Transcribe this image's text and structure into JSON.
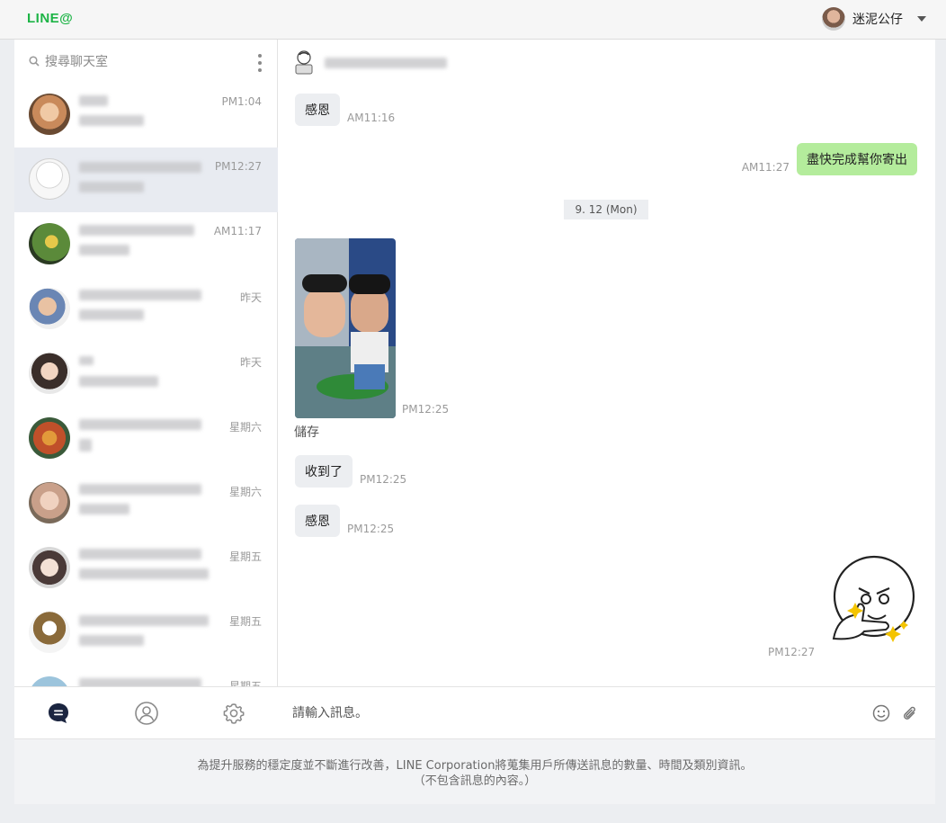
{
  "app": {
    "logo": "LINE@"
  },
  "user": {
    "name": "迷泥公仔"
  },
  "search": {
    "placeholder": "搜尋聊天室"
  },
  "chats": [
    {
      "time": "PM1:04",
      "avatar_color": "#c98a5b"
    },
    {
      "time": "PM12:27",
      "avatar_color": "#f4f4f4"
    },
    {
      "time": "AM11:17",
      "avatar_color": "#5b8a3a"
    },
    {
      "time": "昨天",
      "avatar_color": "#6a86b4"
    },
    {
      "time": "昨天",
      "avatar_color": "#3a2e2a"
    },
    {
      "time": "星期六",
      "avatar_color": "#c0502a"
    },
    {
      "time": "星期六",
      "avatar_color": "#c9a08a"
    },
    {
      "time": "星期五",
      "avatar_color": "#4a3a38"
    },
    {
      "time": "星期五",
      "avatar_color": "#8a6a3a"
    },
    {
      "time": "星期五",
      "avatar_color": "#9cc4dc"
    }
  ],
  "messages": [
    {
      "text": "感恩",
      "time": "AM11:16"
    },
    {
      "text": "盡快完成幫你寄出",
      "time": "AM11:27"
    },
    {
      "date": "9. 12 (Mon)"
    },
    {
      "photo_time": "PM12:25",
      "save_label": "儲存"
    },
    {
      "text": "收到了",
      "time": "PM12:25"
    },
    {
      "text": "感恩",
      "time": "PM12:25"
    },
    {
      "sticker_time": "PM12:27"
    }
  ],
  "composer": {
    "placeholder": "請輸入訊息。"
  },
  "footer": {
    "line1": "為提升服務的穩定度並不斷進行改善，LINE Corporation將蒐集用戶所傳送訊息的數量、時間及類別資訊。",
    "line2": "（不包含訊息的內容。）"
  },
  "colors": {
    "brand": "#1db446",
    "mine_bubble": "#b4ec9c",
    "other_bubble": "#eceef1"
  },
  "icons": [
    "search-icon",
    "more-icon",
    "chat-icon",
    "friends-icon",
    "settings-icon",
    "emoji-icon",
    "attach-icon"
  ]
}
